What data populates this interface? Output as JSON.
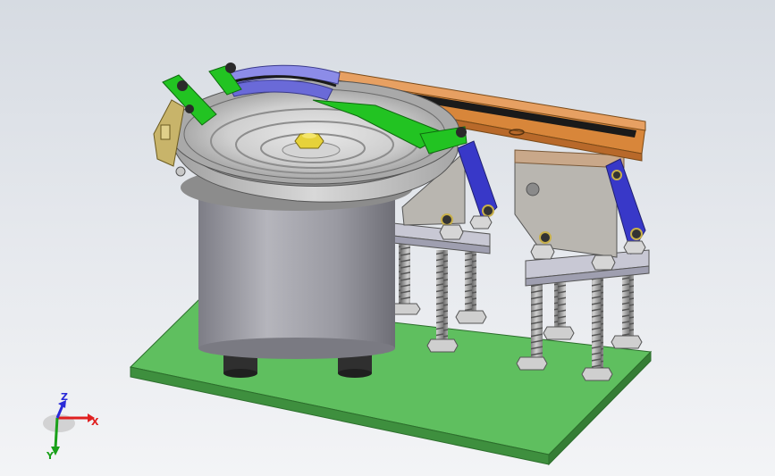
{
  "triad": {
    "x_label": "X",
    "y_label": "Y",
    "z_label": "Z",
    "x_color": "#e02020",
    "y_color": "#19a019",
    "z_color": "#2a2ad8"
  },
  "colors": {
    "base_plate": "#5fbf5f",
    "bowl": "#bfbfbf",
    "drive_cylinder": "#a9a9b0",
    "rail": "#d8863a",
    "bracket": "#3838c8",
    "guide": "#22c322",
    "track_liner": "#8c8ce8"
  }
}
